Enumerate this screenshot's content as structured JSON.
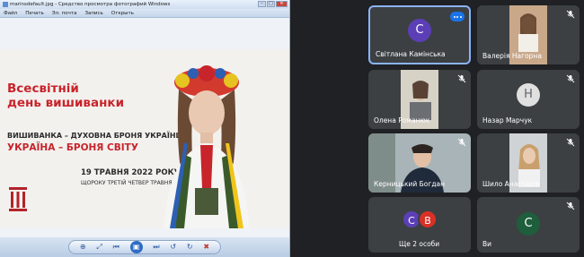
{
  "viewer": {
    "title": "marinsdefault.jpg - Средство просмотра фотографий Windows",
    "menu": [
      "Файл",
      "Печать",
      "Эл. почта",
      "Запись",
      "Открыть"
    ],
    "controls": [
      "zoom-icon",
      "fit-icon",
      "previous-icon",
      "slideshow-icon",
      "next-icon",
      "rotate-left-icon",
      "rotate-right-icon",
      "delete-icon"
    ]
  },
  "poster": {
    "title_line1": "Всесвітній",
    "title_line2": "день вишиванки",
    "line1": "ВИШИВАНКА – ДУХОВНА БРОНЯ УКРАЇНЦІВ",
    "line2": "УКРАЇНА – БРОНЯ СВІТУ",
    "date": "19 ТРАВНЯ 2022 РОКУ",
    "subtitle": "ЩОРОКУ ТРЕТІЙ ЧЕТВЕР ТРАВНЯ"
  },
  "participants": [
    {
      "name": "Світлана Камінська",
      "initial": "С",
      "color": "#5c3fb7",
      "muted": false,
      "active": true
    },
    {
      "name": "Валерія Нагорна",
      "video": true,
      "muted": true
    },
    {
      "name": "Олена Романюк",
      "video": true,
      "muted": true
    },
    {
      "name": "Назар Марчук",
      "initial": "Н",
      "color": "#e0e0e0",
      "muted": true
    },
    {
      "name": "Керницький Богдан",
      "video": true,
      "muted": true
    },
    {
      "name": "Шило Анастасія",
      "video": true,
      "muted": true
    },
    {
      "name": "Ще 2 особи",
      "initials": [
        "С",
        "В"
      ],
      "colors": [
        "#5c3fb7",
        "#d93025"
      ]
    },
    {
      "name": "Ви",
      "initial": "С",
      "color": "#1e5e3c",
      "muted": true
    }
  ]
}
